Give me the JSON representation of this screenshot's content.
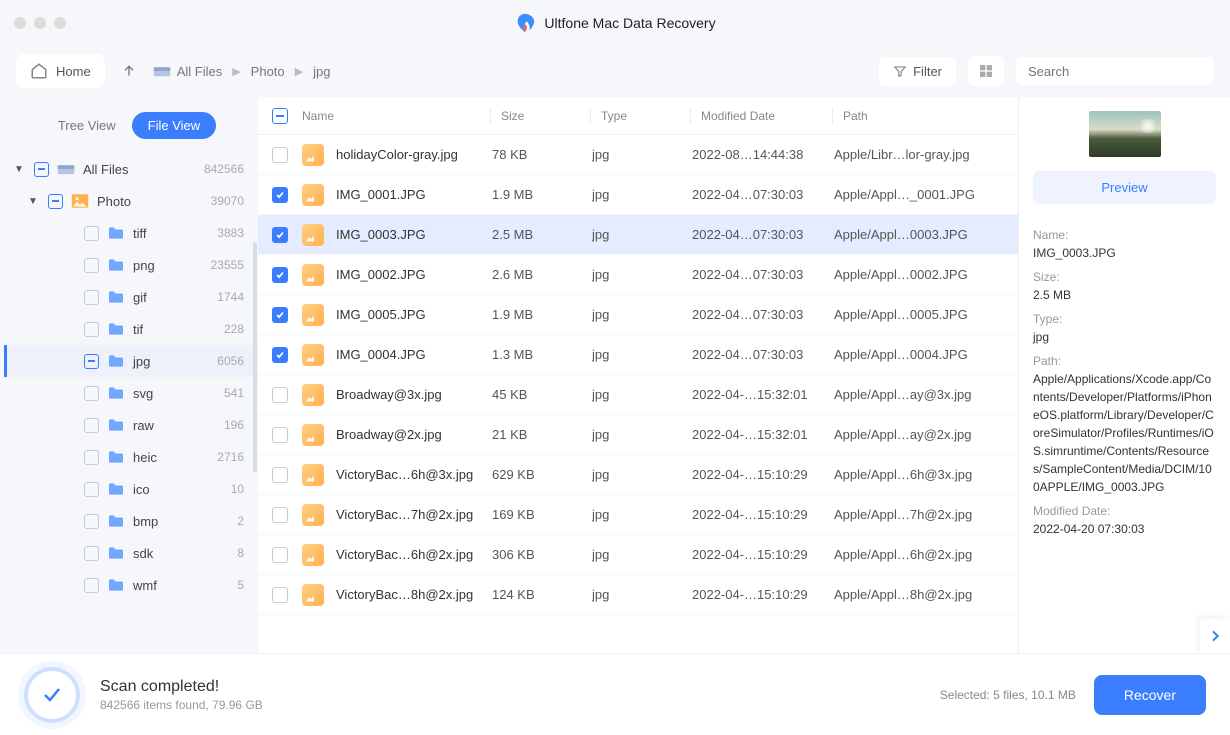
{
  "app": {
    "title": "Ultfone Mac Data Recovery"
  },
  "toolbar": {
    "home": "Home",
    "filter": "Filter",
    "search_placeholder": "Search"
  },
  "breadcrumb": [
    "All Files",
    "Photo",
    "jpg"
  ],
  "view": {
    "tree": "Tree View",
    "file": "File View"
  },
  "tree": {
    "root": {
      "label": "All Files",
      "count": "842566"
    },
    "photo": {
      "label": "Photo",
      "count": "39070"
    },
    "items": [
      {
        "label": "tiff",
        "count": "3883"
      },
      {
        "label": "png",
        "count": "23555"
      },
      {
        "label": "gif",
        "count": "1744"
      },
      {
        "label": "tif",
        "count": "228"
      },
      {
        "label": "jpg",
        "count": "6056",
        "selected": true
      },
      {
        "label": "svg",
        "count": "541"
      },
      {
        "label": "raw",
        "count": "196"
      },
      {
        "label": "heic",
        "count": "2716"
      },
      {
        "label": "ico",
        "count": "10"
      },
      {
        "label": "bmp",
        "count": "2"
      },
      {
        "label": "sdk",
        "count": "8"
      },
      {
        "label": "wmf",
        "count": "5"
      }
    ]
  },
  "columns": {
    "name": "Name",
    "size": "Size",
    "type": "Type",
    "date": "Modified Date",
    "path": "Path"
  },
  "files": [
    {
      "checked": false,
      "name": "holidayColor-gray.jpg",
      "size": "78 KB",
      "type": "jpg",
      "date": "2022-08…14:44:38",
      "path": "Apple/Libr…lor-gray.jpg"
    },
    {
      "checked": true,
      "name": "IMG_0001.JPG",
      "size": "1.9 MB",
      "type": "jpg",
      "date": "2022-04…07:30:03",
      "path": "Apple/Appl…_0001.JPG"
    },
    {
      "checked": true,
      "name": "IMG_0003.JPG",
      "size": "2.5 MB",
      "type": "jpg",
      "date": "2022-04…07:30:03",
      "path": "Apple/Appl…0003.JPG",
      "selected": true
    },
    {
      "checked": true,
      "name": "IMG_0002.JPG",
      "size": "2.6 MB",
      "type": "jpg",
      "date": "2022-04…07:30:03",
      "path": "Apple/Appl…0002.JPG"
    },
    {
      "checked": true,
      "name": "IMG_0005.JPG",
      "size": "1.9 MB",
      "type": "jpg",
      "date": "2022-04…07:30:03",
      "path": "Apple/Appl…0005.JPG"
    },
    {
      "checked": true,
      "name": "IMG_0004.JPG",
      "size": "1.3 MB",
      "type": "jpg",
      "date": "2022-04…07:30:03",
      "path": "Apple/Appl…0004.JPG"
    },
    {
      "checked": false,
      "name": "Broadway@3x.jpg",
      "size": "45 KB",
      "type": "jpg",
      "date": "2022-04-…15:32:01",
      "path": "Apple/Appl…ay@3x.jpg"
    },
    {
      "checked": false,
      "name": "Broadway@2x.jpg",
      "size": "21 KB",
      "type": "jpg",
      "date": "2022-04-…15:32:01",
      "path": "Apple/Appl…ay@2x.jpg"
    },
    {
      "checked": false,
      "name": "VictoryBac…6h@3x.jpg",
      "size": "629 KB",
      "type": "jpg",
      "date": "2022-04-…15:10:29",
      "path": "Apple/Appl…6h@3x.jpg"
    },
    {
      "checked": false,
      "name": "VictoryBac…7h@2x.jpg",
      "size": "169 KB",
      "type": "jpg",
      "date": "2022-04-…15:10:29",
      "path": "Apple/Appl…7h@2x.jpg"
    },
    {
      "checked": false,
      "name": "VictoryBac…6h@2x.jpg",
      "size": "306 KB",
      "type": "jpg",
      "date": "2022-04-…15:10:29",
      "path": "Apple/Appl…6h@2x.jpg"
    },
    {
      "checked": false,
      "name": "VictoryBac…8h@2x.jpg",
      "size": "124 KB",
      "type": "jpg",
      "date": "2022-04-…15:10:29",
      "path": "Apple/Appl…8h@2x.jpg"
    }
  ],
  "preview": {
    "button": "Preview",
    "name_label": "Name:",
    "name": "IMG_0003.JPG",
    "size_label": "Size:",
    "size": "2.5 MB",
    "type_label": "Type:",
    "type": "jpg",
    "path_label": "Path:",
    "path": "Apple/Applications/Xcode.app/Contents/Developer/Platforms/iPhoneOS.platform/Library/Developer/CoreSimulator/Profiles/Runtimes/iOS.simruntime/Contents/Resources/SampleContent/Media/DCIM/100APPLE/IMG_0003.JPG",
    "date_label": "Modified Date:",
    "date": "2022-04-20 07:30:03"
  },
  "footer": {
    "title": "Scan completed!",
    "sub": "842566 items found, 79.96 GB",
    "selected": "Selected: 5 files, 10.1 MB",
    "recover": "Recover"
  }
}
